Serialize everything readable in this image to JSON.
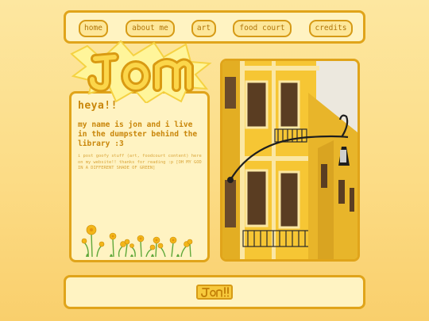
{
  "nav": {
    "items": [
      {
        "label": "home"
      },
      {
        "label": "about me"
      },
      {
        "label": "art"
      },
      {
        "label": "food court"
      },
      {
        "label": "credits"
      }
    ]
  },
  "logo": {
    "text": "Jon"
  },
  "intro": {
    "heading": "heya!!",
    "bio": "my name is jon and i live in the dumpster behind the library :3",
    "small": "i post goofy stuff (art, foodcourt content) here on my website!! thanks for reading :p [OH MY GOD IN A DIFFERENT SHADE OF GREEN]"
  },
  "footer": {
    "badge_text": "Jon!!"
  },
  "colors": {
    "accent": "#e0a41a",
    "text": "#c9860a",
    "panel": "#fff3c2",
    "background": "#fde7a0"
  }
}
